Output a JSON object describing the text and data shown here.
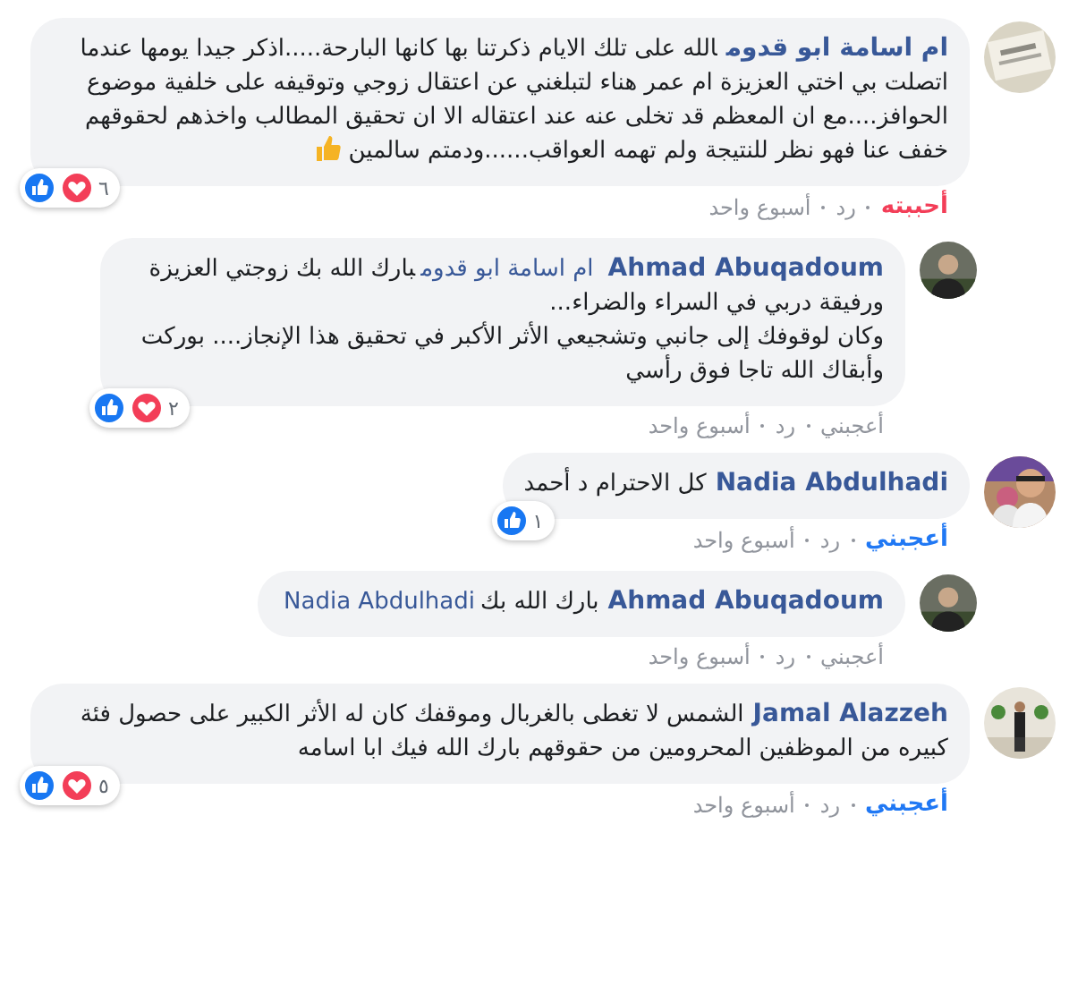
{
  "comments": [
    {
      "author": "ام اسامة ابو قدوم",
      "body": [
        {
          "kind": "text",
          "text": "الله على تلك الايام ذكرتنا بها كانها البارحة.....اذكر جيدا يومها عندما اتصلت بي اختي العزيزة ام عمر هناء لتبلغني عن اعتقال زوجي وتوقيفه على خلفية موضوع الحوافز....مع ان المعظم قد تخلى عنه عند اعتقاله الا ان تحقيق المطالب واخذهم لحقوقهم خفف عنا فهو نظر للنتيجة ولم تهمه العواقب......ودمتم سالمين"
        },
        {
          "kind": "emoji"
        }
      ],
      "reactions": {
        "like": true,
        "love": true
      },
      "reaction_count": "٦",
      "my_like": false,
      "my_love": true,
      "like_label": "أحببته",
      "reply_label": "رد",
      "time": "أسبوع واحد",
      "children": [
        {
          "author": "Ahmad Abuqadoum",
          "body": [
            {
              "kind": "mention",
              "text": "ام اسامة ابو قدوم"
            },
            {
              "kind": "text",
              "text": "بارك الله بك زوجتي العزيزة ورفيقة دربي في السراء والضراء...\nوكان لوقوفك إلى جانبي وتشجيعي الأثر الأكبر في تحقيق هذا الإنجاز.... بوركت وأبقاك الله تاجا فوق رأسي"
            }
          ],
          "reactions": {
            "like": true,
            "love": true
          },
          "reaction_count": "٢",
          "my_like": false,
          "my_love": false,
          "like_label": "أعجبني",
          "reply_label": "رد",
          "time": "أسبوع واحد"
        }
      ]
    },
    {
      "author": "Nadia Abdulhadi",
      "body": [
        {
          "kind": "text",
          "text": "كل الاحترام د أحمد"
        }
      ],
      "reactions": {
        "like": true,
        "love": false
      },
      "reaction_count": "١",
      "my_like": true,
      "my_love": false,
      "like_label": "أعجبني",
      "reply_label": "رد",
      "time": "أسبوع واحد",
      "children": [
        {
          "author": "Ahmad Abuqadoum",
          "body": [
            {
              "kind": "text",
              "text": "بارك الله بك"
            },
            {
              "kind": "mention",
              "text": "Nadia Abdulhadi"
            }
          ],
          "my_like": false,
          "my_love": false,
          "like_label": "أعجبني",
          "reply_label": "رد",
          "time": "أسبوع واحد"
        }
      ]
    },
    {
      "author": "Jamal Alazzeh",
      "body": [
        {
          "kind": "text",
          "text": "الشمس لا تغطى بالغربال وموقفك كان له الأثر الكبير على حصول فئة كبيره من الموظفين المحرومين من حقوقهم بارك الله فيك ابا اسامه"
        }
      ],
      "reactions": {
        "like": true,
        "love": true
      },
      "reaction_count": "٥",
      "my_like": true,
      "my_love": false,
      "like_label": "أعجبني",
      "reply_label": "رد",
      "time": "أسبوع واحد"
    }
  ]
}
